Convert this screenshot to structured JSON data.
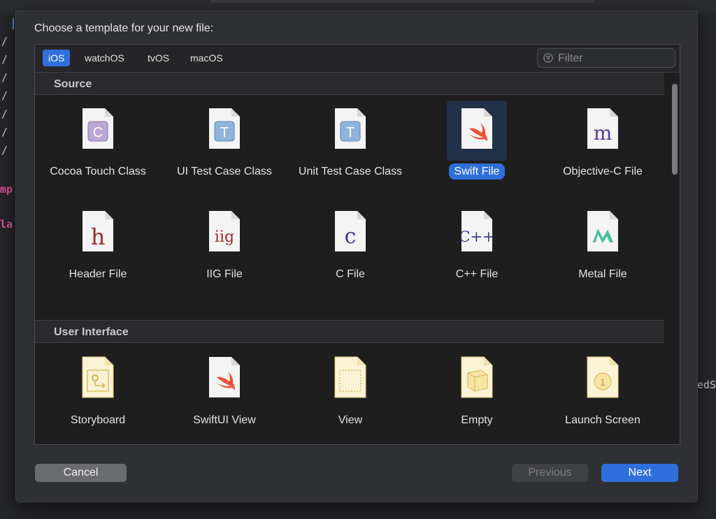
{
  "background": {
    "left_glyphs": [
      "/",
      "/",
      "/",
      "/",
      "/",
      "/",
      "/"
    ],
    "frag_1": "mp",
    "frag_2": "la",
    "frag_right": "edS"
  },
  "dialog": {
    "title": "Choose a template for your new file:",
    "tabs": [
      {
        "label": "iOS",
        "active": true
      },
      {
        "label": "watchOS",
        "active": false
      },
      {
        "label": "tvOS",
        "active": false
      },
      {
        "label": "macOS",
        "active": false
      }
    ],
    "filter_placeholder": "Filter",
    "sections": [
      {
        "title": "Source",
        "items": [
          {
            "label": "Cocoa Touch Class",
            "icon": "cocoa-touch-class-icon",
            "glyph": "C"
          },
          {
            "label": "UI Test Case Class",
            "icon": "ui-test-case-class-icon",
            "glyph": "T"
          },
          {
            "label": "Unit Test Case Class",
            "icon": "unit-test-case-class-icon",
            "glyph": "T"
          },
          {
            "label": "Swift File",
            "icon": "swift-file-icon",
            "glyph": "",
            "selected": true
          },
          {
            "label": "Objective-C File",
            "icon": "objective-c-file-icon",
            "glyph": "m"
          },
          {
            "label": "Header File",
            "icon": "header-file-icon",
            "glyph": "h"
          },
          {
            "label": "IIG File",
            "icon": "iig-file-icon",
            "glyph": "iig"
          },
          {
            "label": "C File",
            "icon": "c-file-icon",
            "glyph": "c"
          },
          {
            "label": "C++ File",
            "icon": "cpp-file-icon",
            "glyph": "C++"
          },
          {
            "label": "Metal File",
            "icon": "metal-file-icon",
            "glyph": ""
          }
        ]
      },
      {
        "title": "User Interface",
        "items": [
          {
            "label": "Storyboard",
            "icon": "storyboard-icon",
            "glyph": ""
          },
          {
            "label": "SwiftUI View",
            "icon": "swiftui-view-icon",
            "glyph": ""
          },
          {
            "label": "View",
            "icon": "view-icon",
            "glyph": ""
          },
          {
            "label": "Empty",
            "icon": "empty-icon",
            "glyph": ""
          },
          {
            "label": "Launch Screen",
            "icon": "launch-screen-icon",
            "glyph": "1"
          }
        ]
      }
    ],
    "buttons": {
      "cancel": "Cancel",
      "previous": "Previous",
      "next": "Next"
    }
  },
  "colors": {
    "accent": "#2f6fdb",
    "sheet_bg": "#2f3034",
    "panel_bg": "#1e1e1e",
    "section_header_bg": "#2a2a2d",
    "selection_tile": "#203148"
  }
}
